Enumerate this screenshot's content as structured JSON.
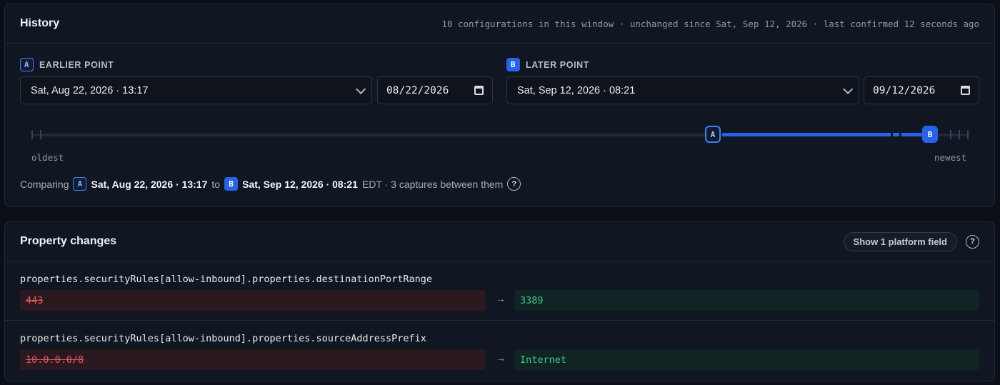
{
  "history": {
    "title": "History",
    "meta": "10 configurations in this window · unchanged since Sat, Sep 12, 2026 · last confirmed 12 seconds ago",
    "earlier": {
      "badge": "A",
      "label": "EARLIER POINT",
      "select_value": "Sat, Aug 22, 2026 · 13:17",
      "date_value": "08/22/2026"
    },
    "later": {
      "badge": "B",
      "label": "LATER POINT",
      "select_value": "Sat, Sep 12, 2026 · 08:21",
      "date_value": "09/12/2026"
    },
    "timeline": {
      "oldest_label": "oldest",
      "newest_label": "newest",
      "handle_a": "A",
      "handle_b": "B"
    },
    "comparing": {
      "prefix": "Comparing",
      "a_badge": "A",
      "a_time": "Sat, Aug 22, 2026 · 13:17",
      "to": "to",
      "b_badge": "B",
      "b_time": "Sat, Sep 12, 2026 · 08:21",
      "suffix": "EDT · 3 captures between them",
      "help": "?"
    }
  },
  "changes": {
    "title": "Property changes",
    "platform_button": "Show 1 platform field",
    "help": "?",
    "rows": [
      {
        "path": "properties.securityRules[allow-inbound].properties.destinationPortRange",
        "old": "443",
        "arrow": "→",
        "new": "3389"
      },
      {
        "path": "properties.securityRules[allow-inbound].properties.sourceAddressPrefix",
        "old": "10.0.0.0/8",
        "arrow": "→",
        "new": "Internet"
      }
    ]
  },
  "colors": {
    "accent": "#2563eb",
    "removed": "#e0575e",
    "added": "#3ec48a",
    "panel_bg": "#111722",
    "page_bg": "#0b0f17"
  },
  "icons": [
    "chevron-down-icon",
    "calendar-icon",
    "help-icon",
    "arrow-right-icon"
  ]
}
